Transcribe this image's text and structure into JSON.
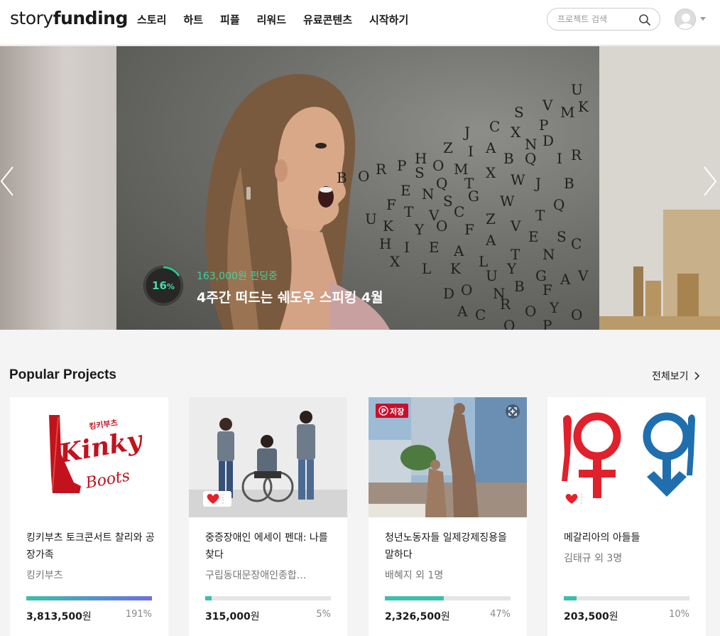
{
  "header": {
    "logo_part1": "story",
    "logo_part2": "funding",
    "nav": [
      "스토리",
      "하트",
      "피플",
      "리워드",
      "유료콘텐츠",
      "시작하기"
    ],
    "search_placeholder": "프로젝트 검색"
  },
  "hero": {
    "progress_percent_value": 16,
    "progress_percent_text": "16",
    "progress_percent_unit": "%",
    "funding_status": "163,000원 펀딩중",
    "title": "4주간 떠드는 쉐도우 스피킹 4월",
    "accent_color": "#3fd3a0"
  },
  "popular": {
    "title": "Popular Projects",
    "see_all": "전체보기",
    "save_badge_label": "저장",
    "projects": [
      {
        "title": "킹키부츠 토크콘서트 찰리와 공장가족",
        "author": "킹키부츠",
        "amount": "3,813,500",
        "currency": "원",
        "percent_text": "191%",
        "percent": 191,
        "bar_color": "gradient-teal-purple",
        "image_text_top": "킹키부츠",
        "image_text_main": "Kinky",
        "image_text_sub": "Boots"
      },
      {
        "title": "중증장애인 에세이 펜대: 나를 찾다",
        "author": "구립동대문장애인종합...",
        "amount": "315,000",
        "currency": "원",
        "percent_text": "5%",
        "percent": 5,
        "bar_color": "#3bbfad"
      },
      {
        "title": "청년노동자들 일제강제징용을 말하다",
        "author": "배혜지 외 1명",
        "amount": "2,326,500",
        "currency": "원",
        "percent_text": "47%",
        "percent": 47,
        "bar_color": "#3bbfad"
      },
      {
        "title": "메갈리아의 아들들",
        "author": "김태규 외 3명",
        "amount": "203,500",
        "currency": "원",
        "percent_text": "10%",
        "percent": 10,
        "bar_color": "#3bbfad"
      }
    ]
  }
}
